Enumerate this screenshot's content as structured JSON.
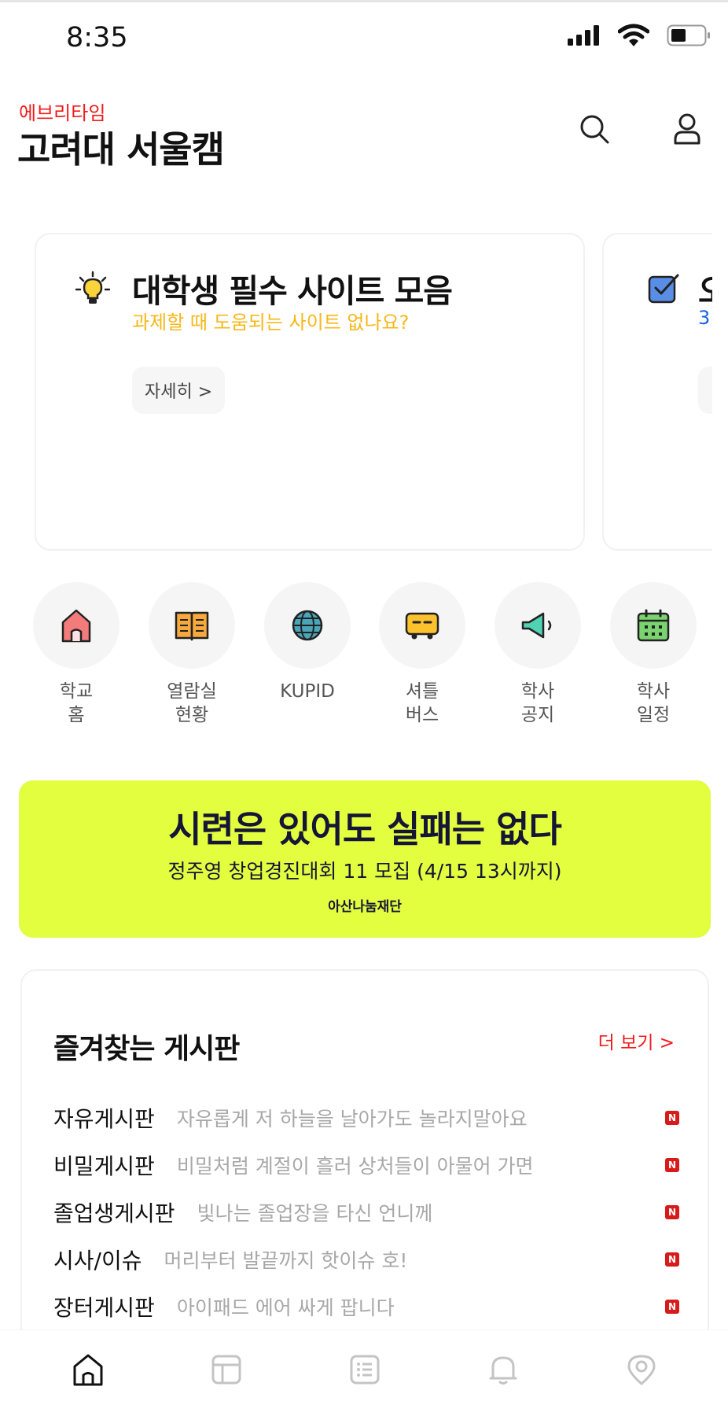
{
  "status_bar": {
    "time": "8:35",
    "icons": [
      "signal-icon",
      "wifi-icon",
      "battery-icon"
    ]
  },
  "header": {
    "app_name": "에브리타임",
    "school": "고려대 서울캠",
    "search_icon": "search-icon",
    "profile_icon": "user-icon"
  },
  "cards": [
    {
      "icon": "lightbulb-icon",
      "title": "대학생 필수 사이트 모음",
      "subtitle": "과제할 때 도움되는 사이트 없나요?",
      "button": "자세히 >",
      "subtitle_color": "#f7b718"
    },
    {
      "icon": "checkbox-icon",
      "title": "오",
      "subtitle": "3",
      "subtitle_color": "#1764e8"
    }
  ],
  "shortcuts": [
    {
      "label": "학교\n홈",
      "icon": "house-icon"
    },
    {
      "label": "열람실\n현황",
      "icon": "book-icon"
    },
    {
      "label": "KUPID",
      "icon": "globe-icon"
    },
    {
      "label": "셔틀\n버스",
      "icon": "bus-icon"
    },
    {
      "label": "학사\n공지",
      "icon": "megaphone-icon"
    },
    {
      "label": "학사\n일정",
      "icon": "calendar-icon"
    }
  ],
  "banner": {
    "title": "시련은 있어도 실패는 없다",
    "subtitle": "정주영 창업경진대회 11 모집 (4/15 13시까지)",
    "sponsor": "아산나눔재단",
    "background": "#e3fd3f"
  },
  "boards": {
    "title": "즐겨찾는 게시판",
    "more": "더 보기 >",
    "new_badge": "N",
    "items": [
      {
        "name": "자유게시판",
        "preview": "자유롭게 저 하늘을 날아가도 놀라지말아요"
      },
      {
        "name": "비밀게시판",
        "preview": "비밀처럼 계절이 흘러 상처들이 아물어 가면"
      },
      {
        "name": "졸업생게시판",
        "preview": "빛나는 졸업장을 타신 언니께"
      },
      {
        "name": "시사/이슈",
        "preview": "머리부터 발끝까지 핫이슈 호!"
      },
      {
        "name": "장터게시판",
        "preview": "아이패드 에어 싸게 팝니다"
      }
    ]
  },
  "tab_bar": {
    "tabs": [
      "home-icon",
      "timetable-icon",
      "list-icon",
      "bell-icon",
      "campus-pin-icon"
    ]
  },
  "colors": {
    "accent": "#f21b1b",
    "new_badge": "#d71a1a"
  }
}
